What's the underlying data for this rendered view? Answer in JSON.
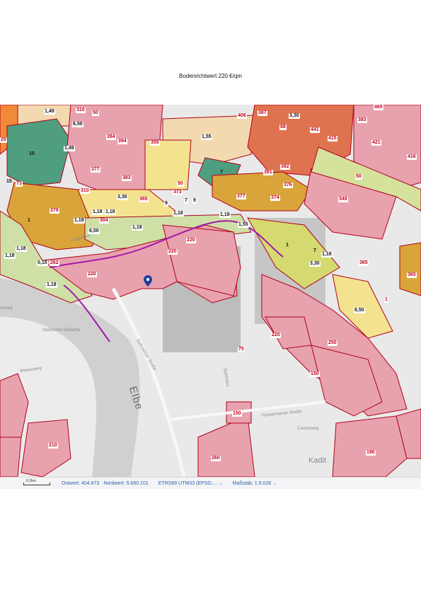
{
  "title": "Bodenrichtwert 220 €/qm",
  "map": {
    "river_name": "Elbe",
    "streets": [
      {
        "id": "selkowitzer",
        "text": "Serkowitzer Straße"
      },
      {
        "id": "elbweg",
        "text": "enweg"
      },
      {
        "id": "stetzsch",
        "text": "Stetzscher Elbiache"
      },
      {
        "id": "wiesenweg",
        "text": "Wiesenweg"
      },
      {
        "id": "fuerstenhain",
        "text": "Fürstenhainer Straße"
      },
      {
        "id": "kaditz",
        "text": "Kadit"
      },
      {
        "id": "caronsweg",
        "text": "Caronsweg"
      },
      {
        "id": "spitzhaus",
        "text": "Spitzhaus"
      },
      {
        "id": "flutgraben",
        "text": "Flutgraben"
      }
    ],
    "land_values": [
      "1,49",
      "310",
      "50",
      "6,50",
      "394",
      "394",
      "355",
      "1,55",
      "406",
      "387",
      "3,30",
      "465",
      "383",
      "88",
      "441",
      "415",
      "421",
      "416",
      "15",
      "1,49",
      "377",
      "383",
      "50",
      "7",
      "381",
      "382",
      "376",
      "50",
      "29",
      "15",
      "73",
      "310",
      "3,30",
      "365",
      "9",
      "373",
      "7",
      "9",
      "377",
      "374",
      "379",
      "349",
      "1",
      "1,18",
      "1,18",
      "304",
      "1,18",
      "1,18",
      "1,55",
      "1,18",
      "6,50",
      "1",
      "1,18",
      "7",
      "1,18",
      "220",
      "220",
      "365",
      "1,18",
      "1,18",
      "3,30",
      "220",
      "0,15",
      "262",
      "1,18",
      "365",
      "1",
      "6,50",
      "220",
      "250",
      "75",
      "150",
      "210",
      "150",
      "260",
      "190"
    ],
    "marker_icon": "location-pin-icon"
  },
  "status_bar": {
    "scale_label": "0.2km",
    "east": "Ostwert: 404.873",
    "north": "Nordwert: 5.660.101",
    "crs": "ETRS89 UTM33 (EPSG:...",
    "scale_text": "Maßstab: 1:9.028",
    "dropdown_icon": "chevron-down-icon"
  },
  "colors": {
    "residential": "#e8a2ae",
    "residential_border": "#b0001a",
    "mixed": "#f3e38f",
    "commercial": "#d9a43a",
    "green": "#4f9e7f",
    "agri": "#cfe0a7",
    "field": "#f2d9b0",
    "boundary": "#a11aa8",
    "river": "#cfcfcf"
  }
}
